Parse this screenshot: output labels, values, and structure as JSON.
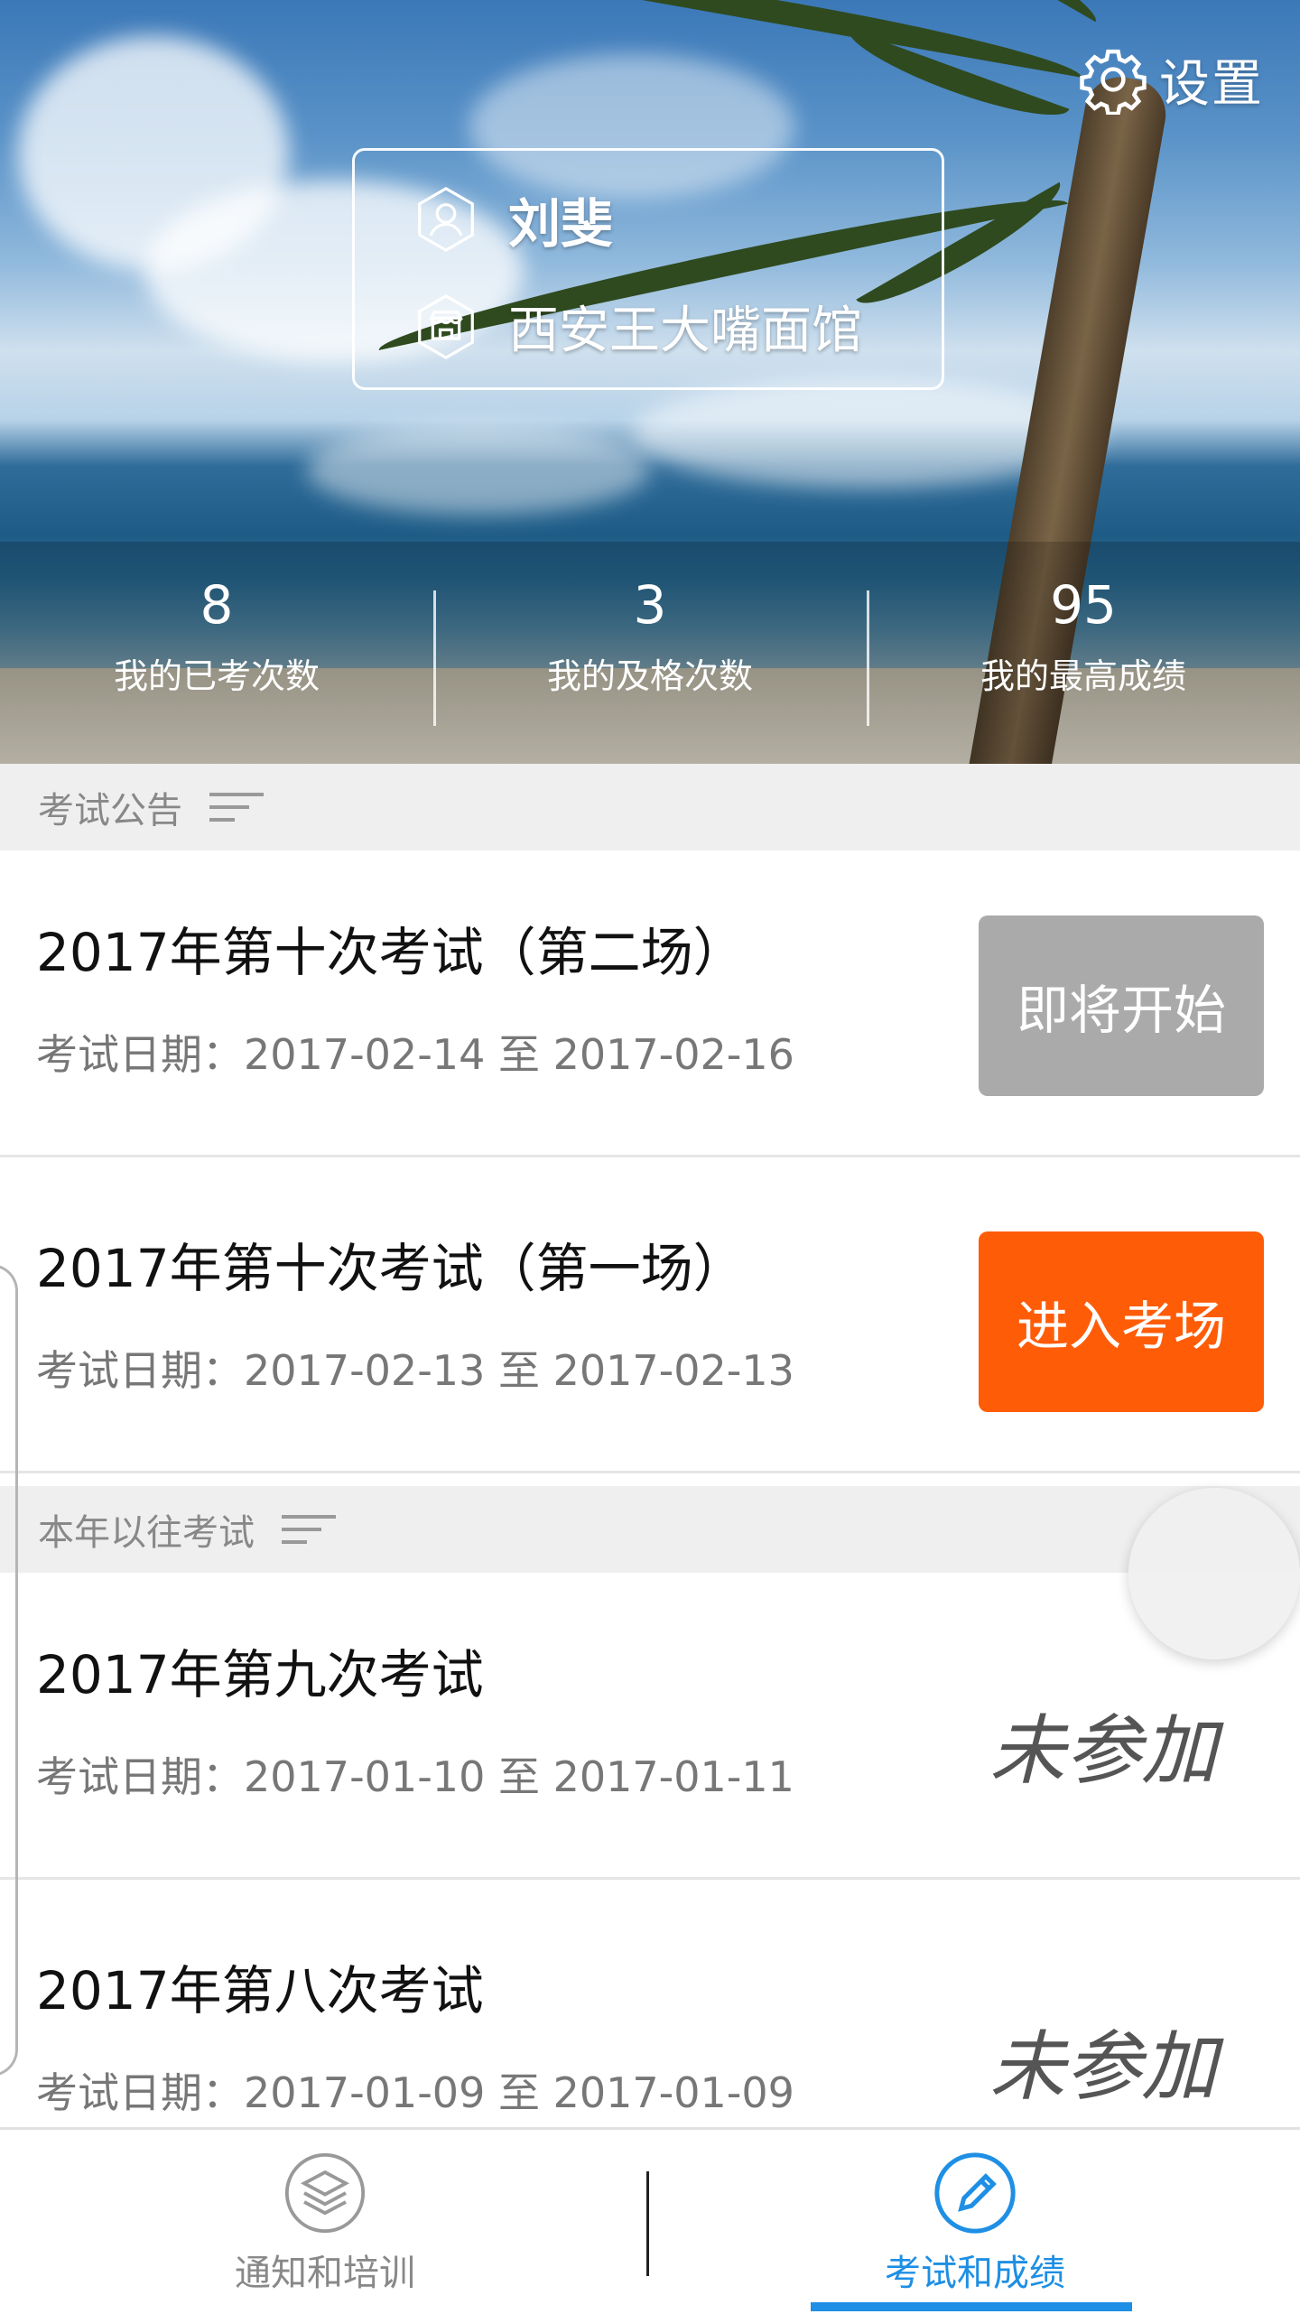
{
  "header": {
    "settings_label": "设置",
    "user_name": "刘斐",
    "shop_name": "西安王大嘴面馆"
  },
  "stats": [
    {
      "value": "8",
      "label": "我的已考次数"
    },
    {
      "value": "3",
      "label": "我的及格次数"
    },
    {
      "value": "95",
      "label": "我的最高成绩"
    }
  ],
  "sections": {
    "announcements": "考试公告",
    "past_exams": "本年以往考试"
  },
  "exams": [
    {
      "title": "2017年第十次考试（第二场）",
      "date": "考试日期：2017-02-14 至 2017-02-16",
      "action": "即将开始"
    },
    {
      "title": "2017年第十次考试（第一场）",
      "date": "考试日期：2017-02-13 至 2017-02-13",
      "action": "进入考场"
    }
  ],
  "past_exams": [
    {
      "title": "2017年第九次考试",
      "date": "考试日期：2017-01-10 至 2017-01-11",
      "status": "未参加"
    },
    {
      "title": "2017年第八次考试",
      "date": "考试日期：2017-01-09 至 2017-01-09",
      "status": "未参加"
    }
  ],
  "bottom_nav": {
    "left_label": "通知和培训",
    "right_label": "考试和成绩"
  },
  "colors": {
    "accent_blue": "#1e8fe4",
    "enter_orange": "#ff5c08",
    "pending_gray": "#aaaaaa"
  }
}
